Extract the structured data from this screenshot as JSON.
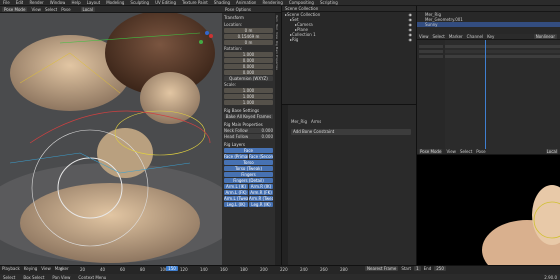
{
  "menubar": {
    "items": [
      "File",
      "Edit",
      "Render",
      "Window",
      "Help",
      "Layout",
      "Modeling",
      "Sculpting",
      "UV Editing",
      "Texture Paint",
      "Shading",
      "Animation",
      "Rendering",
      "Compositing",
      "Scripting"
    ]
  },
  "viewport": {
    "mode": "Pose Mode",
    "header": [
      "View",
      "Select",
      "Pose"
    ],
    "transform_label": "Local",
    "options_label": "Pose Options"
  },
  "npanel": {
    "transform": {
      "title": "Transform",
      "location_label": "Location:",
      "location": [
        "0 m",
        "0.15469 m",
        "0 m"
      ],
      "rotation_label": "Rotation:",
      "rotation": [
        "1.000",
        "0.000",
        "0.000",
        "0.000"
      ],
      "rotation_mode": "Quaternion (WXYZ)",
      "scale_label": "Scale:",
      "scale": [
        "1.000",
        "1.000",
        "1.000"
      ]
    },
    "rig_base": {
      "title": "Rig Base Settings",
      "button": "Bake All Keyed Frames"
    },
    "rig_main": {
      "title": "Rig Main Properties",
      "props": [
        {
          "label": "Neck Follow",
          "value": "0.000"
        },
        {
          "label": "Head Follow",
          "value": "0.000"
        }
      ]
    },
    "rig_layers": {
      "title": "Rig Layers",
      "rows": [
        [
          "Face"
        ],
        [
          "Face (Primary)",
          "Face (Secon..."
        ],
        [
          "Torso"
        ],
        [
          "Torso (Tweak)"
        ],
        [
          "Fingers"
        ],
        [
          "Fingers (Detail)"
        ],
        [
          "Arm.L (IK)",
          "Arm.R (IK)"
        ],
        [
          "Arm.L (FK)",
          "Arm.R (FK)"
        ],
        [
          "Arm.L (Tweak)",
          "Arm.R (Tweak)"
        ],
        [
          "Leg.L (IK)",
          "Leg.R (IK)"
        ]
      ]
    },
    "tabs": [
      "Item",
      "Tool",
      "View",
      "Rig Main Properties"
    ]
  },
  "outliner": {
    "header": "Scene Collection",
    "items": [
      {
        "label": "Scene Collection",
        "indent": 0
      },
      {
        "label": "Set",
        "indent": 1
      },
      {
        "label": "Camera",
        "indent": 2
      },
      {
        "label": "Plane",
        "indent": 2
      },
      {
        "label": "Collection 1",
        "indent": 1
      },
      {
        "label": "Rig",
        "indent": 1
      }
    ]
  },
  "outliner2": {
    "items": [
      {
        "label": "Mer_Rig",
        "selected": false
      },
      {
        "label": "Mer_Geometry.001",
        "selected": false
      },
      {
        "label": "Sunny",
        "selected": true
      }
    ]
  },
  "dopesheet": {
    "header": [
      "View",
      "Select",
      "Marker",
      "Channel",
      "Key"
    ],
    "mode": "Nonlinear"
  },
  "constraints": {
    "header": [
      "Mer_Rig",
      "Arms"
    ],
    "add_label": "Add Bone Constraint"
  },
  "preview": {
    "mode": "Pose Mode",
    "header": [
      "View",
      "Select",
      "Pose"
    ],
    "transform_label": "Local"
  },
  "timeline": {
    "header": [
      "Playback",
      "Keying",
      "View",
      "Marker"
    ],
    "ticks": [
      "0",
      "20",
      "40",
      "60",
      "80",
      "100",
      "120",
      "140",
      "160",
      "180",
      "200",
      "220",
      "240",
      "260",
      "280"
    ],
    "current_frame": "150",
    "right_label": "Nearest Frame",
    "start": "Start",
    "start_value": "1",
    "end": "End",
    "end_value": "250"
  },
  "statusbar": {
    "left": [
      "Select",
      "Box Select",
      "Pan View",
      "Context Menu"
    ],
    "version": "2.90.0"
  }
}
